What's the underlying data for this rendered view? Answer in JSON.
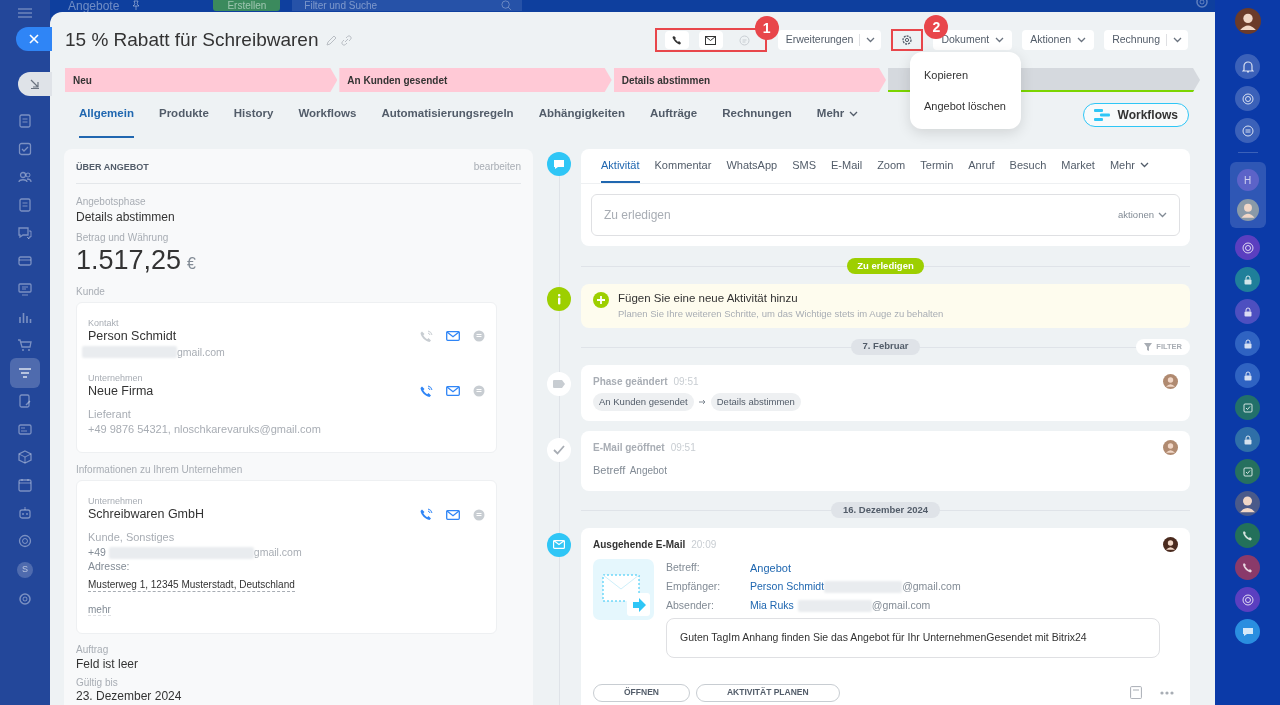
{
  "app": {
    "title": "Angebote",
    "create_button": "Erstellen",
    "search": {
      "placeholder": "Filter und Suche"
    },
    "rail_avatar_letter": "S",
    "chat_letter": "H"
  },
  "slider": {
    "title": "15 % Rabatt für Schreibwaren",
    "header_buttons": [
      {
        "label": "Erweiterungen",
        "kind": "split"
      },
      {
        "label": "Dokument",
        "kind": "dropdown"
      },
      {
        "label": "Aktionen",
        "kind": "dropdown"
      },
      {
        "label": "Rechnung",
        "kind": "split"
      }
    ],
    "annotations": [
      "1",
      "2"
    ],
    "settings_menu": {
      "items": [
        "Kopieren",
        "Angebot löschen"
      ]
    },
    "stages": [
      {
        "label": "Neu",
        "reached": true
      },
      {
        "label": "An Kunden gesendet",
        "reached": true
      },
      {
        "label": "Details abstimmen",
        "reached": true
      },
      {
        "reached": false
      }
    ],
    "tabs": [
      {
        "label": "Allgemein",
        "selected": true
      },
      {
        "label": "Produkte",
        "selected": false
      },
      {
        "label": "History",
        "selected": false
      },
      {
        "label": "Workflows",
        "selected": false
      },
      {
        "label": "Automatisierungsregeln",
        "selected": false
      },
      {
        "label": "Abhängigkeiten",
        "selected": false
      },
      {
        "label": "Aufträge",
        "selected": false
      },
      {
        "label": "Rechnungen",
        "selected": false
      },
      {
        "label": "Mehr",
        "selected": false,
        "kind": "more"
      }
    ],
    "workflows_button": "Workflows"
  },
  "details": {
    "title": "ÜBER ANGEBOT",
    "edit": "bearbeiten",
    "phase": {
      "label": "Angebotsphase",
      "value": "Details abstimmen"
    },
    "amount": {
      "label": "Betrag und Währung",
      "value": "1.517,25",
      "currency": "€"
    },
    "client": {
      "label": "Kunde",
      "entries": [
        {
          "label": "Kontakt",
          "name": "Person Schmidt",
          "call_enabled": false,
          "lines": [
            {
              "suffix": "gmail.com",
              "redacted": true
            }
          ]
        },
        {
          "label": "Unternehmen",
          "name": "Neue Firma",
          "call_enabled": true,
          "lines": [
            {
              "text": "Lieferant",
              "redacted": false
            },
            {
              "text": "+49 9876 54321, nloschkarevaruks@gmail.com",
              "redacted": false
            }
          ]
        }
      ]
    },
    "company": {
      "label": "Informationen zu Ihrem Unternehmen",
      "entries": [
        {
          "label": "Unternehmen",
          "name": "Schreibwaren GmbH",
          "call_enabled": true,
          "lines": [
            {
              "text": "Kunde, Sonstiges",
              "redacted": false
            },
            {
              "prefix": "+49",
              "suffix": "gmail.com",
              "redacted": true
            }
          ],
          "address_label": "Adresse:",
          "address": "Musterweg 1, 12345 Musterstadt, Deutschland",
          "more": "mehr"
        }
      ]
    },
    "order": {
      "label": "Auftrag",
      "value": "Feld ist leer"
    },
    "valid_until": {
      "label": "Gültig bis",
      "value": "23. Dezember 2024"
    }
  },
  "composer": {
    "tabs": [
      {
        "label": "Aktivität",
        "selected": true
      },
      {
        "label": "Kommentar",
        "selected": false
      },
      {
        "label": "WhatsApp",
        "selected": false
      },
      {
        "label": "SMS",
        "selected": false
      },
      {
        "label": "E-Mail",
        "selected": false
      },
      {
        "label": "Zoom",
        "selected": false
      },
      {
        "label": "Termin",
        "selected": false
      },
      {
        "label": "Anruf",
        "selected": false
      },
      {
        "label": "Besuch",
        "selected": false
      },
      {
        "label": "Market",
        "selected": false
      },
      {
        "label": "Mehr",
        "selected": false,
        "kind": "more"
      }
    ],
    "placeholder": "Zu erledigen",
    "actions": "aktionen"
  },
  "timeline": [
    {
      "kind": "badge",
      "label": "Zu erledigen"
    },
    {
      "kind": "hint",
      "title": "Fügen Sie eine neue Aktivität hinzu",
      "text": "Planen Sie Ihre weiteren Schritte, um das Wichtige stets im Auge zu behalten"
    },
    {
      "kind": "date",
      "label": "7. Februar",
      "filter": "FILTER"
    },
    {
      "kind": "phase",
      "title": "Phase geändert",
      "time": "09:51",
      "from": "An Kunden gesendet",
      "to": "Details abstimmen"
    },
    {
      "kind": "opened",
      "title": "E-Mail geöffnet",
      "time": "09:51",
      "label": "Betreff",
      "subject": "Angebot"
    },
    {
      "kind": "date",
      "label": "16. Dezember 2024"
    },
    {
      "kind": "email",
      "title": "Ausgehende E-Mail",
      "time": "20:09",
      "fields": [
        {
          "label": "Betreff:",
          "value": "Angebot",
          "redacted": false
        },
        {
          "label": "Empfänger:",
          "value": "Person Schmidt",
          "domain": "@gmail.com",
          "redacted": true
        },
        {
          "label": "Absender:",
          "value": "Mia Ruks",
          "domain": "@gmail.com",
          "redacted": true
        }
      ],
      "body": "Guten TagIm Anhang finden Sie das Angebot für Ihr UnternehmenGesendet mit Bitrix24",
      "buttons": [
        "ÖFFNEN",
        "AKTIVITÄT PLANEN"
      ]
    }
  ]
}
